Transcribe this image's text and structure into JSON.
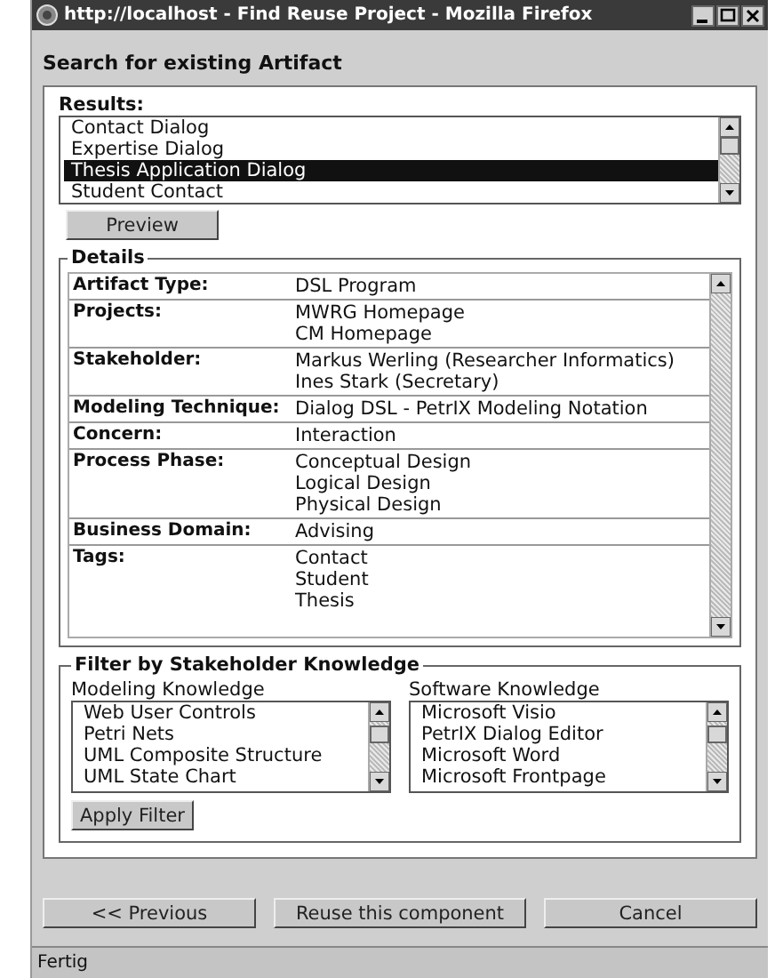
{
  "window": {
    "title": "http://localhost - Find Reuse Project - Mozilla Firefox"
  },
  "heading": "Search for existing Artifact",
  "results": {
    "label": "Results:",
    "items": [
      {
        "label": "Contact Dialog",
        "selected": false
      },
      {
        "label": "Expertise Dialog",
        "selected": false
      },
      {
        "label": "Thesis Application Dialog",
        "selected": true
      },
      {
        "label": "Student Contact",
        "selected": false
      }
    ]
  },
  "preview_button": "Preview",
  "details": {
    "legend": "Details",
    "rows": [
      {
        "label": "Artifact Type:",
        "values": [
          "DSL Program"
        ]
      },
      {
        "label": "Projects:",
        "values": [
          "MWRG Homepage",
          "CM Homepage"
        ]
      },
      {
        "label": "Stakeholder:",
        "values": [
          "Markus Werling (Researcher Informatics)",
          "Ines Stark (Secretary)"
        ]
      },
      {
        "label": "Modeling Technique:",
        "values": [
          "Dialog DSL - PetrIX Modeling Notation"
        ]
      },
      {
        "label": "Concern:",
        "values": [
          "Interaction"
        ]
      },
      {
        "label": "Process Phase:",
        "values": [
          "Conceptual Design",
          "Logical Design",
          "Physical Design"
        ]
      },
      {
        "label": "Business Domain:",
        "values": [
          "Advising"
        ]
      },
      {
        "label": "Tags:",
        "values": [
          "Contact",
          "Student",
          "Thesis"
        ]
      }
    ]
  },
  "filter": {
    "legend": "Filter by Stakeholder Knowledge",
    "lists": [
      {
        "label": "Modeling Knowledge",
        "items": [
          "Web User Controls",
          "Petri Nets",
          "UML Composite Structure",
          "UML State Chart"
        ]
      },
      {
        "label": "Software Knowledge",
        "items": [
          "Microsoft Visio",
          "PetrIX Dialog Editor",
          "Microsoft Word",
          "Microsoft Frontpage"
        ]
      }
    ],
    "apply_button": "Apply Filter"
  },
  "buttons": [
    "<< Previous",
    "Reuse this component",
    "Cancel"
  ],
  "status_bar": "Fertig"
}
